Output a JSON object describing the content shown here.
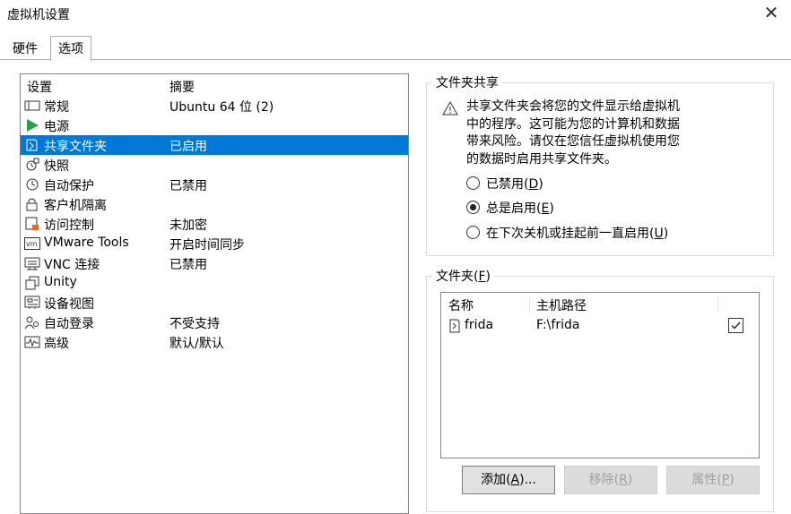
{
  "window": {
    "title": "虚拟机设置",
    "close_glyph": "✕"
  },
  "tabs": [
    {
      "label": "硬件",
      "active": false
    },
    {
      "label": "选项",
      "active": true
    }
  ],
  "settings_list": {
    "header": {
      "setting": "设置",
      "summary": "摘要"
    },
    "items": [
      {
        "icon": "general-icon",
        "label": "常规",
        "summary": "Ubuntu 64 位 (2)"
      },
      {
        "icon": "power-icon",
        "label": "电源",
        "summary": ""
      },
      {
        "icon": "shared-folder-icon",
        "label": "共享文件夹",
        "summary": "已启用",
        "selected": true
      },
      {
        "icon": "snapshot-icon",
        "label": "快照",
        "summary": ""
      },
      {
        "icon": "autoprotect-icon",
        "label": "自动保护",
        "summary": "已禁用"
      },
      {
        "icon": "lock-icon",
        "label": "客户机隔离",
        "summary": ""
      },
      {
        "icon": "access-control-icon",
        "label": "访问控制",
        "summary": "未加密"
      },
      {
        "icon": "vmware-tools-icon",
        "label": "VMware Tools",
        "summary": "开启时间同步"
      },
      {
        "icon": "vnc-icon",
        "label": "VNC 连接",
        "summary": "已禁用"
      },
      {
        "icon": "unity-icon",
        "label": "Unity",
        "summary": ""
      },
      {
        "icon": "device-view-icon",
        "label": "设备视图",
        "summary": ""
      },
      {
        "icon": "autologin-icon",
        "label": "自动登录",
        "summary": "不受支持"
      },
      {
        "icon": "advanced-icon",
        "label": "高级",
        "summary": "默认/默认"
      }
    ]
  },
  "folder_sharing": {
    "legend": "文件夹共享",
    "warning_lines": [
      "共享文件夹会将您的文件显示给虚拟机",
      "中的程序。这可能为您的计算机和数据",
      "带来风险。请仅在您信任虚拟机使用您",
      "的数据时启用共享文件夹。"
    ],
    "options": [
      {
        "label": "已禁用",
        "key": "D",
        "checked": false
      },
      {
        "label": "总是启用",
        "key": "E",
        "checked": true
      },
      {
        "label": "在下次关机或挂起前一直启用",
        "key": "U",
        "checked": false
      }
    ]
  },
  "folders": {
    "legend_label": "文件夹",
    "legend_key": "F",
    "columns": {
      "name": "名称",
      "host_path": "主机路径"
    },
    "rows": [
      {
        "name": "frida",
        "host_path": "F:\\frida",
        "enabled": true
      }
    ],
    "buttons": {
      "add": {
        "label": "添加",
        "key": "A",
        "suffix": "...",
        "enabled": true
      },
      "remove": {
        "label": "移除",
        "key": "R",
        "suffix": "",
        "enabled": false
      },
      "properties": {
        "label": "属性",
        "key": "P",
        "suffix": "",
        "enabled": false
      }
    }
  },
  "colors": {
    "selection": "#0078d7",
    "power_green": "#2ea043",
    "lock_orange": "#e46a1f"
  }
}
